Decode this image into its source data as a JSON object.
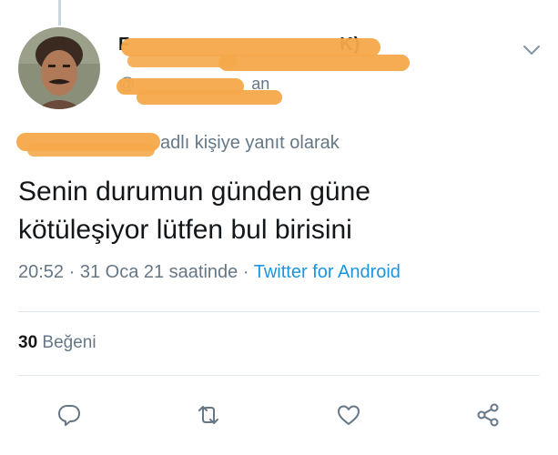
{
  "tweet": {
    "display_name": "F",
    "display_name_end": "K)",
    "handle": "@",
    "handle_end": "an",
    "reply_to_suffix": "adlı kişiye yanıt olarak",
    "text_line1": "Senin durumun günden güne",
    "text_line2": "kötüleşiyor lütfen bul birisini",
    "time": "20:52",
    "date_phrase": "31 Oca 21 saatinde",
    "separator": " · ",
    "source": "Twitter for Android",
    "like_count": "30",
    "like_label": "Beğeni"
  },
  "icons": {
    "caret": "chevron-down-icon",
    "reply": "comment-bubble-icon",
    "retweet": "retweet-icon",
    "like": "heart-icon",
    "share": "share-icon"
  },
  "colors": {
    "redaction": "#f5a84a",
    "secondary_text": "#657786",
    "link": "#1b95e0",
    "icon": "#657786",
    "divider": "#e1e8ed"
  }
}
